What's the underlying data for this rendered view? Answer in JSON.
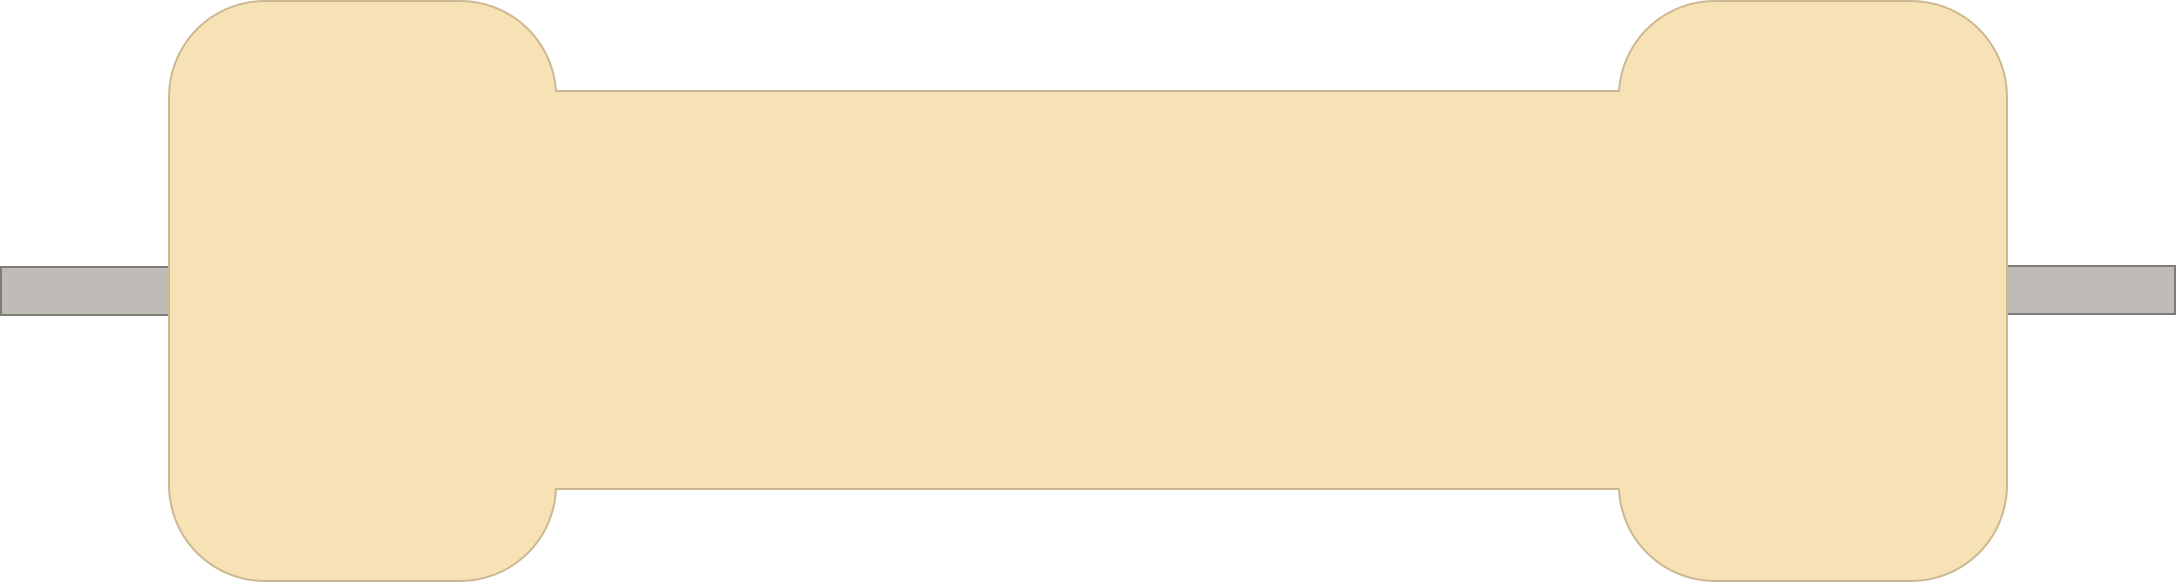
{
  "component": {
    "type": "axial resistor",
    "body_color": "#F7E2B5",
    "body_outline_color": "#CDB894",
    "lead_color": "#BFBBB6",
    "lead_outline_color": "#7F7C78",
    "background_color": "#FFFFFF"
  }
}
